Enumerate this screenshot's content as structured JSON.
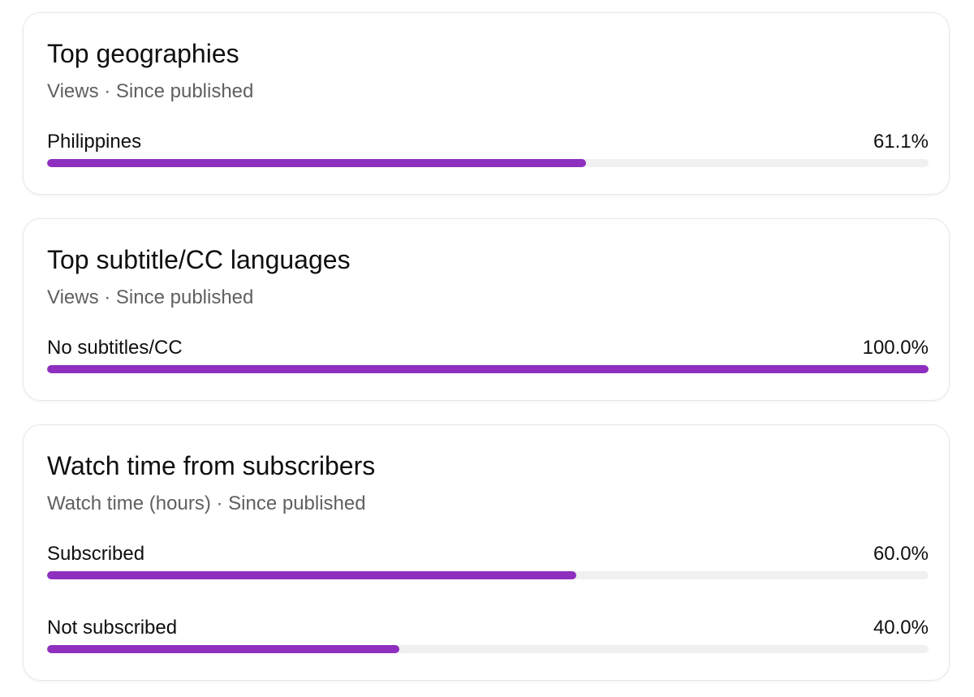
{
  "accent_color": "#8e2fbf",
  "track_color": "#f0f0f0",
  "cards": [
    {
      "title": "Top geographies",
      "subtitle": "Views · Since published",
      "rows": [
        {
          "label": "Philippines",
          "value": "61.1%",
          "fraction": 0.611
        }
      ]
    },
    {
      "title": "Top subtitle/CC languages",
      "subtitle": "Views · Since published",
      "rows": [
        {
          "label": "No subtitles/CC",
          "value": "100.0%",
          "fraction": 1.0
        }
      ]
    },
    {
      "title": "Watch time from subscribers",
      "subtitle": "Watch time (hours) · Since published",
      "rows": [
        {
          "label": "Subscribed",
          "value": "60.0%",
          "fraction": 0.6
        },
        {
          "label": "Not subscribed",
          "value": "40.0%",
          "fraction": 0.4
        }
      ]
    }
  ]
}
